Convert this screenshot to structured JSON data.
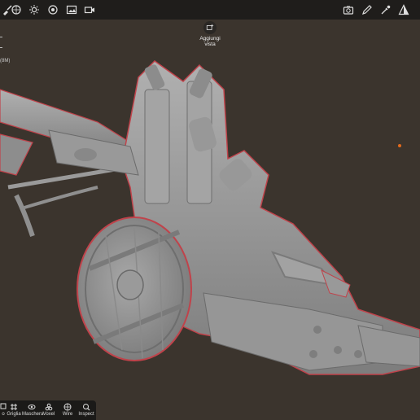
{
  "topbar": {
    "left_icons": [
      "brush-icon",
      "sphere-icon",
      "sun-icon",
      "material-icon",
      "image-icon",
      "video-icon"
    ],
    "right_icons": [
      "camera-icon",
      "pencil-icon",
      "eyedropper-icon",
      "shading-icon"
    ]
  },
  "add_view": {
    "label_line1": "Aggiungi",
    "label_line2": "vista"
  },
  "side_info": {
    "text": "(8M)"
  },
  "bottom_toolbar": {
    "items": [
      {
        "label": "o",
        "icon": "partial-icon"
      },
      {
        "label": "Griglia",
        "icon": "grid-icon"
      },
      {
        "label": "Maschera",
        "icon": "eye-icon"
      },
      {
        "label": "Voxel",
        "icon": "voxel-icon"
      },
      {
        "label": "Wire",
        "icon": "wire-icon"
      },
      {
        "label": "Inspect",
        "icon": "inspect-icon"
      }
    ]
  },
  "colors": {
    "background": "#3b342d",
    "model": "#9a9a9a",
    "outline": "#c0434b",
    "dot": "#e36a1c"
  }
}
